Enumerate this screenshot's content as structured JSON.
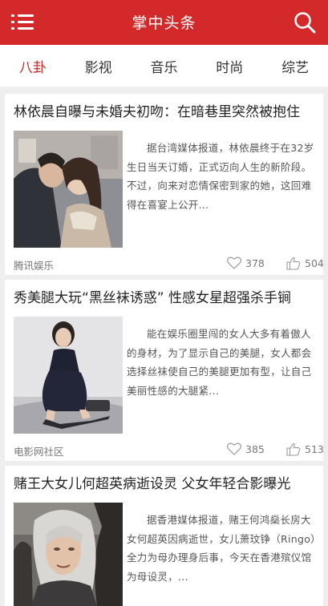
{
  "header": {
    "title": "掌中头条",
    "menu_icon": "list-menu-icon",
    "search_icon": "search-icon",
    "bg_color": "#d3292a"
  },
  "tabs": [
    {
      "label": "八卦",
      "active": true
    },
    {
      "label": "影视",
      "active": false
    },
    {
      "label": "音乐",
      "active": false
    },
    {
      "label": "时尚",
      "active": false
    },
    {
      "label": "综艺",
      "active": false
    }
  ],
  "articles": [
    {
      "title": "林依晨自曝与未婚夫初吻：在暗巷里突然被抱住",
      "summary": "据台湾媒体报道，林依晨终于在32岁生日当天订婚，正式迈向人生的新阶段。不过，向来对恋情保密到家的她，这回难得在喜宴上公开...",
      "source": "腾讯娱乐",
      "likes": "378",
      "thumbs": "504"
    },
    {
      "title": "秀美腿大玩“黑丝袜诱惑” 性感女星超强杀手锏",
      "summary": "能在娱乐圈里闯的女人大多有着傲人的身材，为了显示自己的美腿，女人都会选择丝袜使自己的美腿更加有型，让自己美丽性感的大腿紧...",
      "source": "电影网社区",
      "likes": "385",
      "thumbs": "513"
    },
    {
      "title": "赌王大女儿何超英病逝设灵 父女年轻合影曝光",
      "summary": "据香港媒体报道，赌王何鸿燊长房大女何超英因病逝世，女儿萧玟铮（Ringo）全力为母办理身后事，今天在香港殡仪馆为母设灵，...",
      "source": "",
      "likes": "",
      "thumbs": ""
    }
  ]
}
